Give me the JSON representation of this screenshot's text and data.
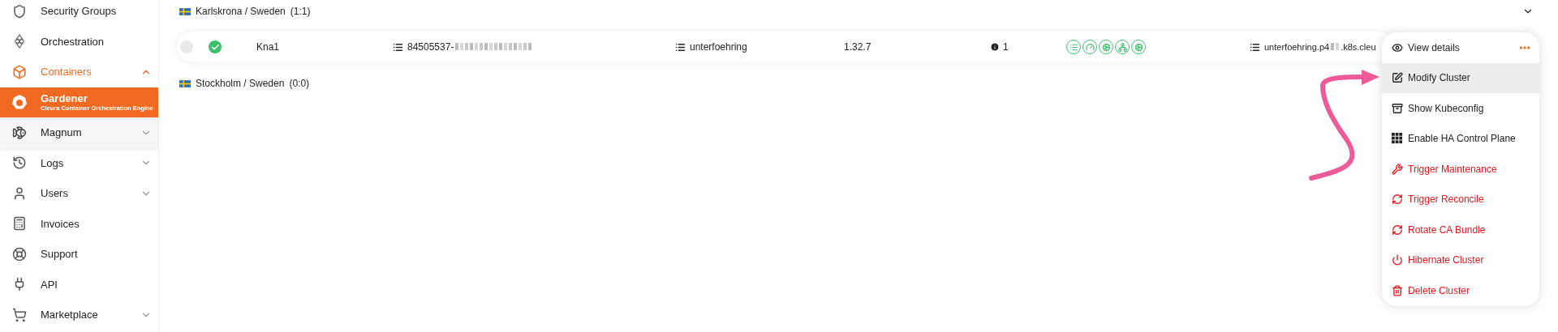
{
  "sidebar": {
    "items": [
      {
        "label": "Security Groups",
        "selected": false
      },
      {
        "label": "Orchestration",
        "selected": false
      },
      {
        "label": "Containers",
        "selected": true,
        "expanded": true,
        "children": [
          {
            "label": "Gardener",
            "subtitle": "Cleura Container Orchestration Engine",
            "selected": true
          },
          {
            "label": "Magnum",
            "selected": false,
            "expanded": false
          }
        ]
      },
      {
        "label": "Logs",
        "selected": false,
        "expanded": false
      },
      {
        "label": "Users",
        "selected": false,
        "expanded": false
      },
      {
        "label": "Invoices",
        "selected": false
      },
      {
        "label": "Support",
        "selected": false
      },
      {
        "label": "API",
        "selected": false
      },
      {
        "label": "Marketplace",
        "selected": false,
        "expanded": false
      }
    ]
  },
  "regions": [
    {
      "label": "Karlskrona / Sweden",
      "count": "(1:1)",
      "expanded": true,
      "clusters": [
        {
          "selected": false,
          "healthy": true,
          "name": "Kna1",
          "id": "84505537-",
          "location": "unterfoehring",
          "version": "1.32.7",
          "warnings": "1",
          "endpoint_start": "unterfoehring.p4",
          "endpoint_end": ".k8s.cleu"
        }
      ]
    },
    {
      "label": "Stockholm / Sweden",
      "count": "(0:0)"
    }
  ],
  "menu": {
    "items": [
      {
        "label": "View details",
        "kind": "normal",
        "highlighted": false
      },
      {
        "label": "Modify Cluster",
        "kind": "normal",
        "highlighted": true
      },
      {
        "label": "Show Kubeconfig",
        "kind": "normal",
        "highlighted": false
      },
      {
        "label": "Enable HA Control Plane",
        "kind": "normal",
        "highlighted": false
      },
      {
        "label": "Trigger Maintenance",
        "kind": "danger",
        "highlighted": false
      },
      {
        "label": "Trigger Reconcile",
        "kind": "danger",
        "highlighted": false
      },
      {
        "label": "Rotate CA Bundle",
        "kind": "danger",
        "highlighted": false
      },
      {
        "label": "Hibernate Cluster",
        "kind": "danger",
        "highlighted": false
      },
      {
        "label": "Delete Cluster",
        "kind": "danger",
        "highlighted": false
      }
    ]
  }
}
